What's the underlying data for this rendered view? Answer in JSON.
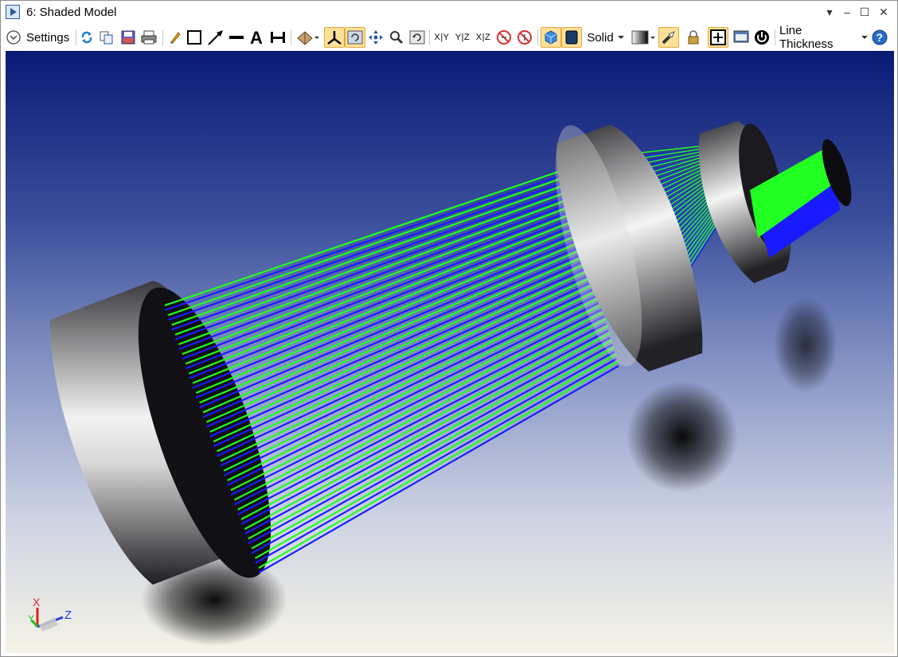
{
  "window": {
    "title": "6: Shaded Model",
    "controls": [
      "▾",
      "–",
      "☐",
      "✕"
    ]
  },
  "toolbar": {
    "settings_label": "Settings",
    "axis_buttons": [
      "X|Y",
      "Y|Z",
      "X|Z"
    ],
    "draw_mode_label": "Solid",
    "line_thickness_label": "Line Thickness"
  },
  "viewport": {
    "axis_labels": {
      "x": "X",
      "y": "Y",
      "z": "Z"
    },
    "colors": {
      "background_top": "#0b1a75",
      "background_bottom": "#f5f3e6",
      "ray_green": "#22ff22",
      "ray_blue": "#1a1aff",
      "lens_metal": "#a8a8a8"
    }
  }
}
